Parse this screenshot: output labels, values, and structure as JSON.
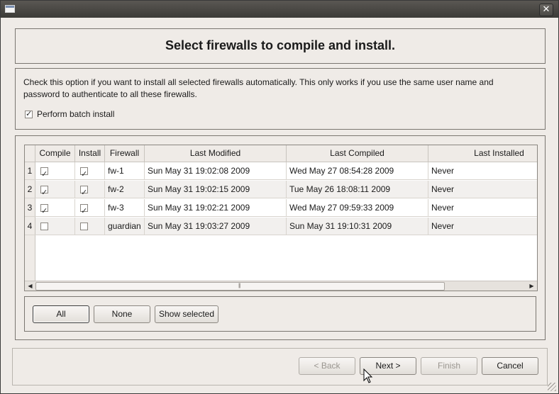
{
  "window": {
    "title": "",
    "close_glyph": "✕"
  },
  "header": {
    "title": "Select firewalls to compile and install."
  },
  "options": {
    "description": "Check this option if you want to install all selected firewalls automatically. This only works if you use the same user name and password to authenticate to all these firewalls.",
    "batch_install_label": "Perform batch install",
    "batch_install_checked": true
  },
  "table": {
    "columns": [
      "Compile",
      "Install",
      "Firewall",
      "Last Modified",
      "Last Compiled",
      "Last Installed"
    ],
    "rows": [
      {
        "num": "1",
        "compile": true,
        "install": true,
        "firewall": "fw-1",
        "last_modified": "Sun May 31 19:02:08 2009",
        "last_compiled": "Wed May 27 08:54:28 2009",
        "last_installed": "Never"
      },
      {
        "num": "2",
        "compile": true,
        "install": true,
        "firewall": "fw-2",
        "last_modified": "Sun May 31 19:02:15 2009",
        "last_compiled": "Tue May 26 18:08:11 2009",
        "last_installed": "Never"
      },
      {
        "num": "3",
        "compile": true,
        "install": true,
        "firewall": "fw-3",
        "last_modified": "Sun May 31 19:02:21 2009",
        "last_compiled": "Wed May 27 09:59:33 2009",
        "last_installed": "Never"
      },
      {
        "num": "4",
        "compile": false,
        "install": false,
        "firewall": "guardian",
        "last_modified": "Sun May 31 19:03:27 2009",
        "last_compiled": "Sun May 31 19:10:31 2009",
        "last_installed": "Never"
      }
    ]
  },
  "selection_buttons": {
    "all": "All",
    "none": "None",
    "show_selected": "Show selected"
  },
  "nav": {
    "back": "< Back",
    "next": "Next >",
    "finish": "Finish",
    "cancel": "Cancel"
  },
  "icons": {
    "window": "window-icon",
    "close": "close-icon",
    "scroll_left": "arrow-left-icon",
    "scroll_right": "arrow-right-icon",
    "cursor": "mouse-pointer-icon",
    "resize": "resize-grip-icon"
  }
}
